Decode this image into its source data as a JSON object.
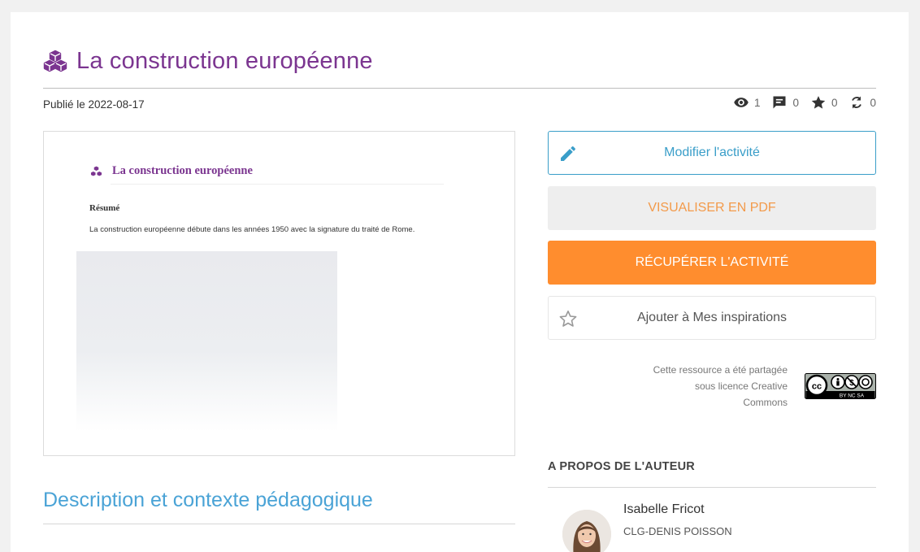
{
  "activity": {
    "title": "La construction européenne",
    "published": "Publié le 2022-08-17",
    "icon": "cubes-icon"
  },
  "stats": {
    "views": "1",
    "comments": "0",
    "favorites": "0",
    "shares": "0"
  },
  "preview": {
    "title": "La construction européenne",
    "resume_label": "Résumé",
    "resume_text": "La construction européenne débute dans les années 1950 avec la signature du traité de Rome."
  },
  "description": {
    "title": "Description et contexte pédagogique"
  },
  "actions": {
    "edit_label": "Modifier l'activité",
    "pdf_label": "VISUALISER EN PDF",
    "get_label": "RÉCUPÉRER L'ACTIVITÉ",
    "inspiration_label": "Ajouter à Mes inspirations"
  },
  "license": {
    "line1": "Cette ressource a été partagée",
    "line2": "sous licence Creative",
    "line3": "Commons",
    "badge": "BY NC SA"
  },
  "author": {
    "section_title": "A PROPOS DE L'AUTEUR",
    "name": "Isabelle Fricot",
    "school": "CLG-DENIS POISSON"
  },
  "colors": {
    "title": "#7b3590",
    "accent_blue": "#3a9ec9",
    "accent_orange": "#ff8d2e",
    "description_title": "#4aa3d6"
  }
}
